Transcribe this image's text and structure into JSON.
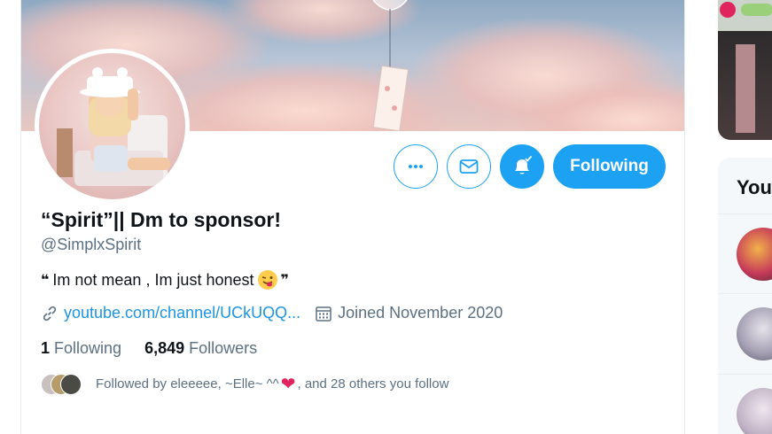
{
  "profile": {
    "display_name": "“Spirit”|| Dm to sponsor!",
    "handle": "@SimplxSpirit",
    "bio_text": "Im not mean , Im just honest",
    "bio_open_quote": "❝",
    "bio_close_quote": "❞",
    "bio_emoji": "winking-tongue-emoji",
    "website": "youtube.com/channel/UCkUQQ...",
    "joined": "Joined November 2020",
    "following_count": "1",
    "following_label": "Following",
    "followers_count": "6,849",
    "followers_label": "Followers",
    "followed_by_prefix": "Followed by eleeeee, ~Elle~ ^^",
    "followed_by_suffix": ", and 28 others you follow"
  },
  "actions": {
    "more_icon": "more-icon",
    "message_icon": "mail-icon",
    "notify_icon": "bell-check-icon",
    "follow_label": "Following"
  },
  "sidebar": {
    "panel_title": "You"
  },
  "colors": {
    "accent": "#1da1f2",
    "link": "#1b95e0",
    "secondary_text": "#5b7083",
    "heart": "#e0245e"
  }
}
